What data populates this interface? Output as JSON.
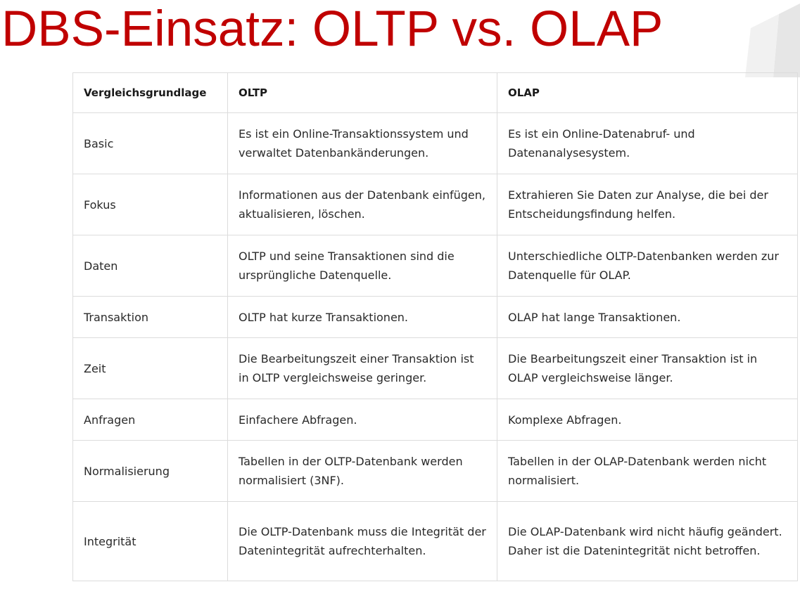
{
  "slide": {
    "title": "DBS-Einsatz: OLTP vs. OLAP"
  },
  "colors": {
    "title": "#c00000",
    "border": "#dcdcdc",
    "text": "#2a2a2a"
  },
  "table": {
    "headers": [
      "Vergleichsgrundlage",
      "OLTP",
      "OLAP"
    ],
    "rows": [
      {
        "basis": "Basic",
        "oltp": "Es ist ein Online-Transaktionssystem und verwaltet Datenbankänderungen.",
        "olap": "Es ist ein Online-Datenabruf- und Datenanalysesystem."
      },
      {
        "basis": "Fokus",
        "oltp": "Informationen aus der Datenbank einfügen, aktualisieren, löschen.",
        "olap": "Extrahieren Sie Daten zur Analyse, die bei der Entscheidungsfindung helfen."
      },
      {
        "basis": "Daten",
        "oltp": "OLTP und seine Transaktionen sind die ursprüngliche Datenquelle.",
        "olap": "Unterschiedliche OLTP-Datenbanken werden zur Datenquelle für OLAP."
      },
      {
        "basis": "Transaktion",
        "oltp": "OLTP hat kurze Transaktionen.",
        "olap": "OLAP hat lange Transaktionen."
      },
      {
        "basis": "Zeit",
        "oltp": "Die Bearbeitungszeit einer Transaktion ist in OLTP vergleichsweise geringer.",
        "olap": "Die Bearbeitungszeit einer Transaktion ist in OLAP vergleichsweise länger."
      },
      {
        "basis": "Anfragen",
        "oltp": "Einfachere Abfragen.",
        "olap": "Komplexe Abfragen."
      },
      {
        "basis": "Normalisierung",
        "oltp": "Tabellen in der OLTP-Datenbank werden normalisiert (3NF).",
        "olap": "Tabellen in der OLAP-Datenbank werden nicht normalisiert."
      },
      {
        "basis": "Integrität",
        "oltp": "Die OLTP-Datenbank muss die Integrität der Datenintegrität aufrechterhalten.",
        "olap": "Die OLAP-Datenbank wird nicht häufig geändert. Daher ist die Datenintegrität nicht betroffen."
      }
    ]
  }
}
